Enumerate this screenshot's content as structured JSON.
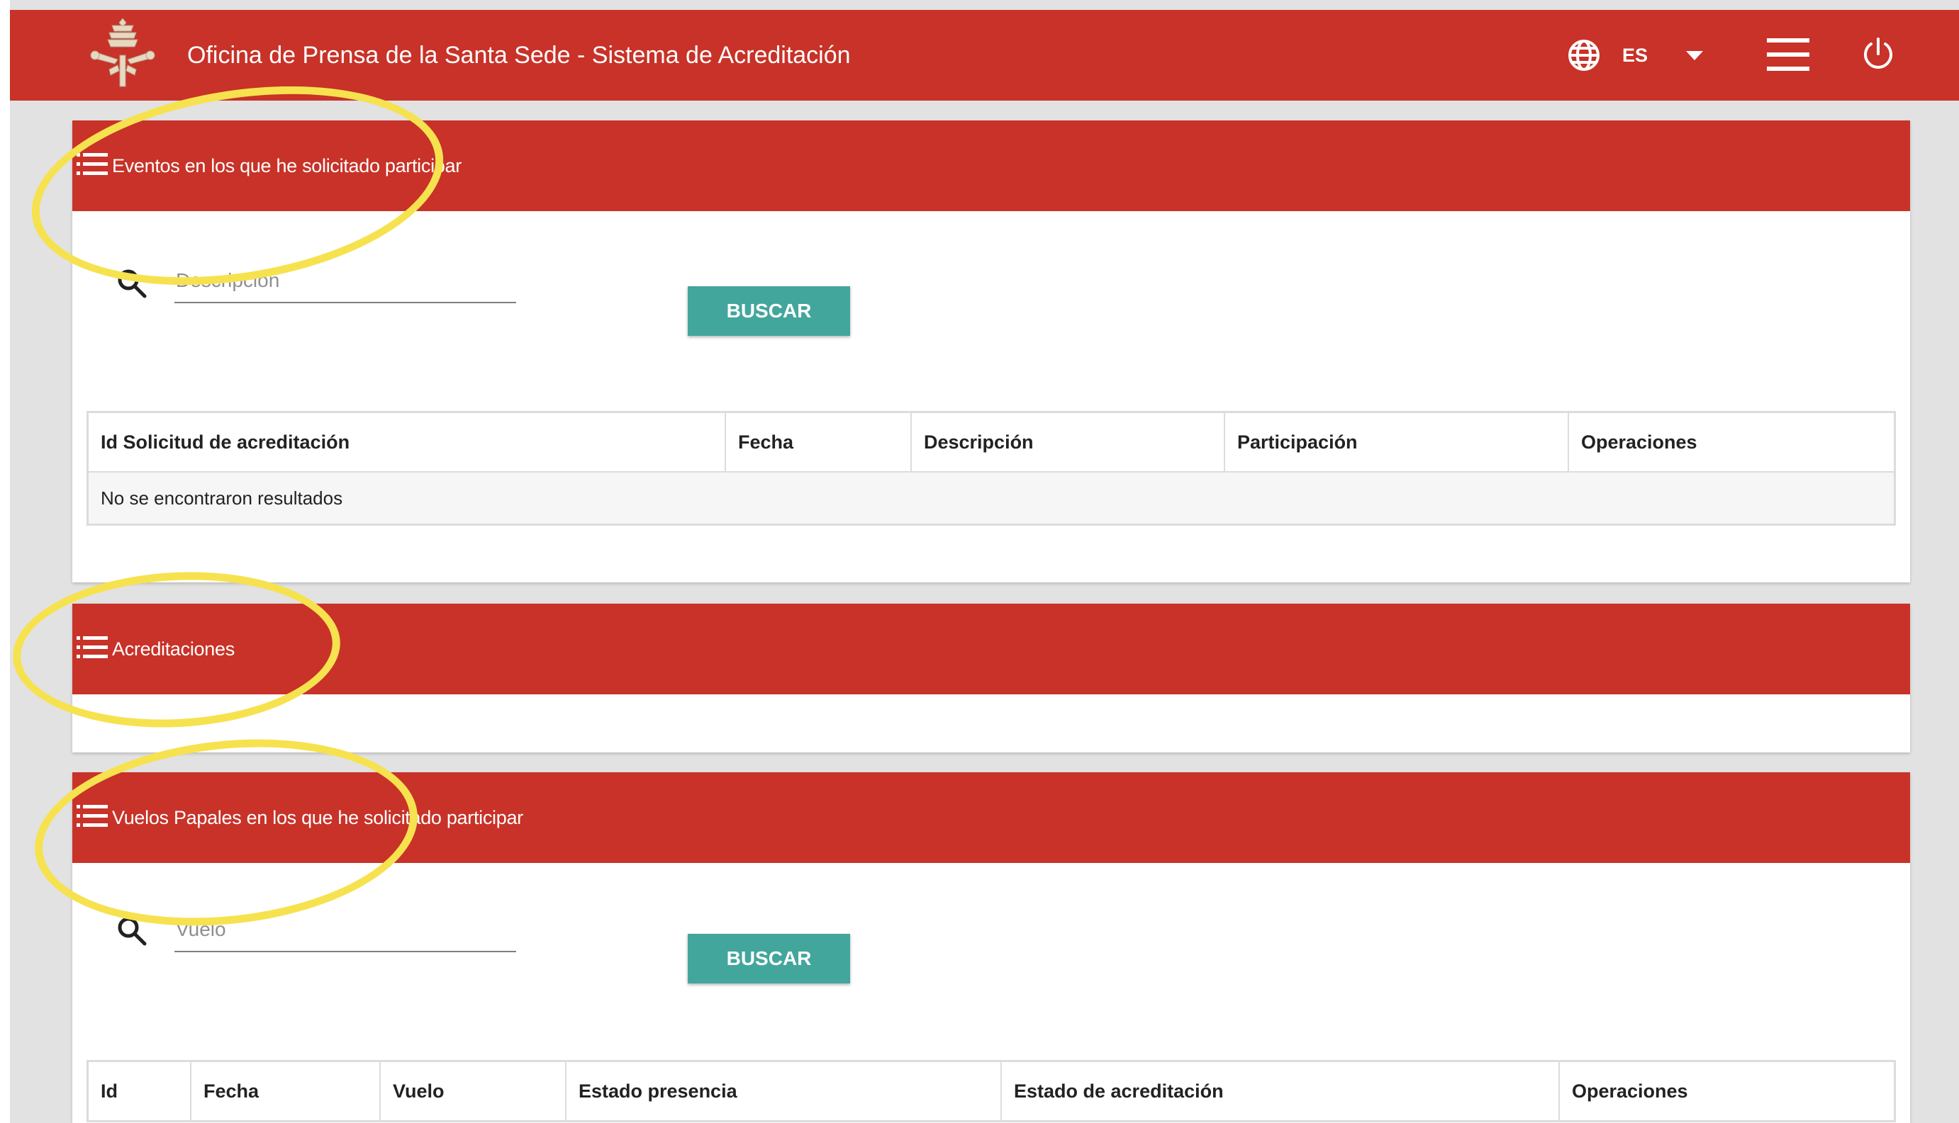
{
  "header": {
    "title": "Oficina de Prensa de la Santa Sede - Sistema de Acreditación",
    "language": "ES",
    "icons": [
      "vatican-coat-of-arms-logo",
      "globe-icon",
      "caret-down-icon",
      "menu-icon",
      "power-icon"
    ],
    "color": "#c83228"
  },
  "events": {
    "title": "Eventos en los que he solicitado participar",
    "search_placeholder": "Descripción",
    "button": "BUSCAR",
    "columns": [
      "Id Solicitud de acreditación",
      "Fecha",
      "Descripción",
      "Participación",
      "Operaciones"
    ],
    "empty_message": "No se encontraron resultados"
  },
  "accreditations": {
    "title": "Acreditaciones"
  },
  "flights": {
    "title": "Vuelos Papales en los que he solicitado participar",
    "search_placeholder": "Vuelo",
    "button": "BUSCAR",
    "columns": [
      "Id",
      "Fecha",
      "Vuelo",
      "Estado presencia",
      "Estado de acreditación",
      "Operaciones"
    ]
  },
  "colors": {
    "brand_red": "#c83228",
    "button_teal": "#43a69c",
    "highlight_yellow": "#f6e24e"
  }
}
